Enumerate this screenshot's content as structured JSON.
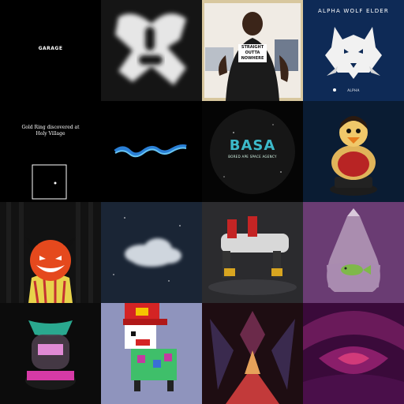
{
  "tiles": [
    {
      "name": "garage",
      "label": "GARAGE"
    },
    {
      "name": "white-glyph"
    },
    {
      "name": "meme-photo",
      "shirt_text": "STRAIGHT OUTTA NOWHERE"
    },
    {
      "name": "alpha-wolf-elder",
      "title": "ALPHA WOLF ELDER",
      "footer": "ALPHA"
    },
    {
      "name": "gold-ring",
      "text": "Gold Ring discovered at Holy Village"
    },
    {
      "name": "blue-ribbon"
    },
    {
      "name": "basa",
      "title": "BASA",
      "subtitle": "BORED APE SPACE AGENCY"
    },
    {
      "name": "duck-figurine"
    },
    {
      "name": "pumpkin-character"
    },
    {
      "name": "cloud-space"
    },
    {
      "name": "mech-robot"
    },
    {
      "name": "fish-bag"
    },
    {
      "name": "pod-capsule"
    },
    {
      "name": "pixel-character"
    },
    {
      "name": "fractal-red"
    },
    {
      "name": "fractal-purple"
    }
  ],
  "colors": {
    "basa_accent": "#3cb9c9",
    "wolf_bg": "#0e2a56",
    "fish_bag_bg": "#6a3c73",
    "pixel_bg": "#8f94bd"
  }
}
